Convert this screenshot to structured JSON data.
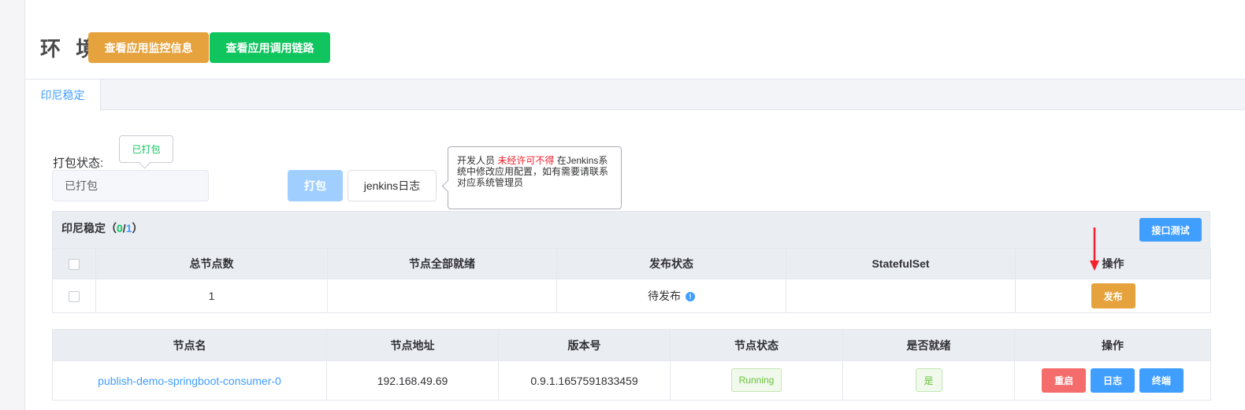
{
  "header": {
    "title": "环 境",
    "monitor_button": "查看应用监控信息",
    "trace_button": "查看应用调用链路"
  },
  "tabs": [
    {
      "label": "印尼稳定"
    }
  ],
  "pack": {
    "label": "打包状态:",
    "tooltip": "已打包",
    "value": "已打包",
    "pack_button": "打包",
    "jenkins_button": "jenkins日志"
  },
  "warning": {
    "prefix": "开发人员 ",
    "highlight": "未经许可不得",
    "suffix": " 在Jenkins系统中修改应用配置，如有需要请联系对应系统管理员"
  },
  "panel": {
    "name": "印尼稳定",
    "open": "（",
    "ready": "0",
    "sep": "/",
    "total": "1",
    "close": "）",
    "api_test_button": "接口测试"
  },
  "summary_table": {
    "headers": [
      "总节点数",
      "节点全部就绪",
      "发布状态",
      "StatefulSet",
      "操作"
    ],
    "row": {
      "total_nodes": "1",
      "all_ready": "",
      "publish_status": "待发布",
      "statefulset": "",
      "action": "发布"
    }
  },
  "node_table": {
    "headers": [
      "节点名",
      "节点地址",
      "版本号",
      "节点状态",
      "是否就绪",
      "操作"
    ],
    "rows": [
      {
        "name": "publish-demo-springboot-consumer-0",
        "address": "192.168.49.69",
        "version": "0.9.1.1657591833459",
        "status": "Running",
        "ready": "是",
        "actions": [
          "重启",
          "日志",
          "终端"
        ]
      }
    ]
  },
  "colors": {
    "orange": "#e6a23c",
    "green": "#10c55e",
    "blue": "#409eff",
    "red": "#f56c6c"
  }
}
